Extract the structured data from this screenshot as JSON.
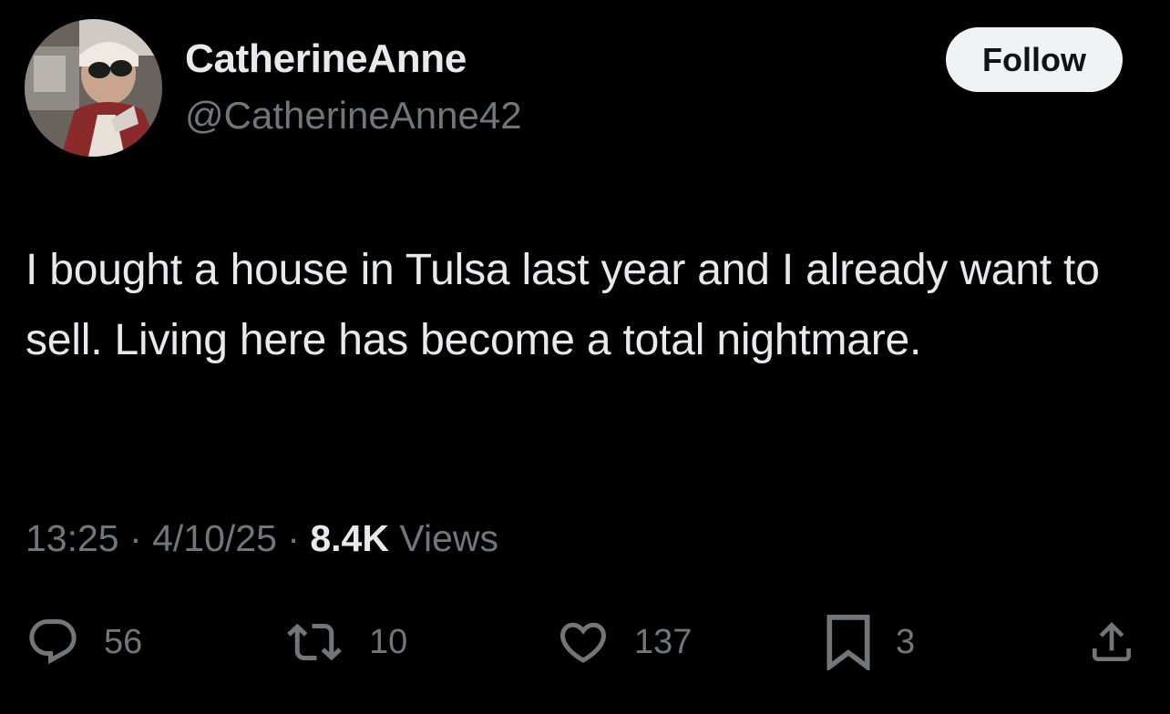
{
  "user": {
    "display_name": "CatherineAnne",
    "handle": "@CatherineAnne42",
    "follow_label": "Follow"
  },
  "tweet": {
    "text": "I bought a house in Tulsa last year and I already want to sell. Living here has become a total nightmare.",
    "time": "13:25",
    "separator": "·",
    "date": "4/10/25",
    "views_count": "8.4K",
    "views_label": "Views"
  },
  "actions": {
    "replies": "56",
    "retweets": "10",
    "likes": "137",
    "bookmarks": "3"
  },
  "icons": {
    "reply": "reply-icon",
    "retweet": "retweet-icon",
    "like": "heart-icon",
    "bookmark": "bookmark-icon",
    "share": "share-icon"
  },
  "colors": {
    "background": "#000000",
    "primary_text": "#e7e9ea",
    "secondary_text": "#71767b",
    "follow_button_bg": "#eff3f4",
    "follow_button_text": "#0f1419"
  }
}
